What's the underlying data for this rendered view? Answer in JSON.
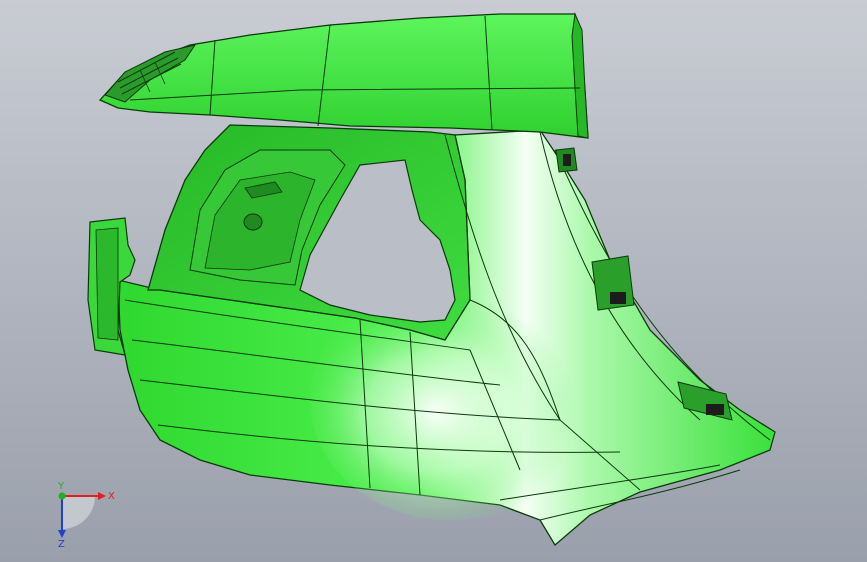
{
  "viewport": {
    "model_color": "#33e433",
    "edge_color": "#0a3a0a",
    "background_top": "#c9ccd3",
    "background_bottom": "#9aa0ab"
  },
  "triad": {
    "x_label": "X",
    "y_label": "Y",
    "z_label": "Z",
    "x_color": "#e02020",
    "y_color": "#20b020",
    "z_color": "#2040d0"
  }
}
